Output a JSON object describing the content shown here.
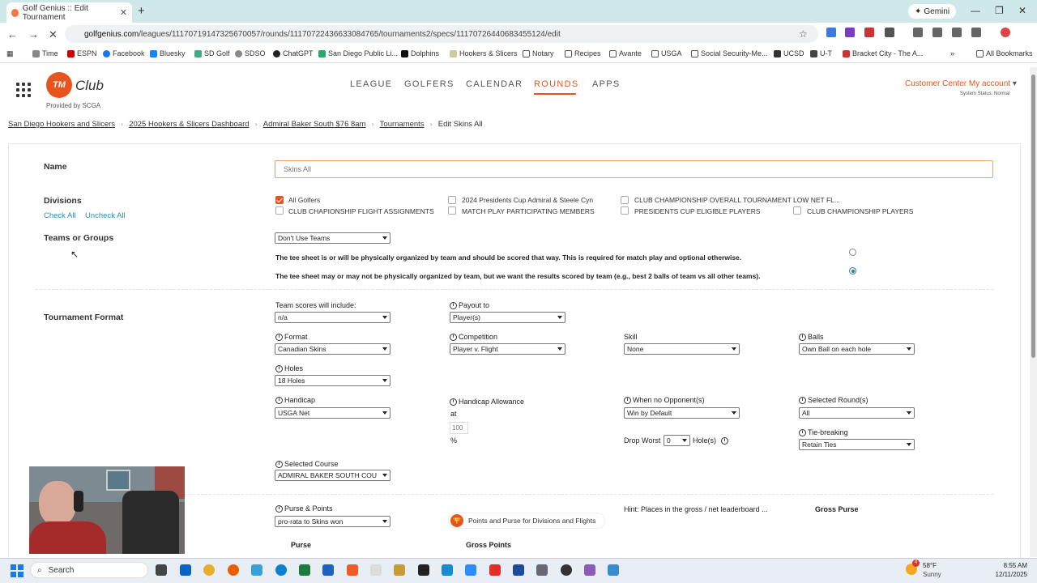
{
  "browser": {
    "tab_title": "Golf Genius :: Edit Tournament",
    "url_host": "golfgenius.com",
    "url_path": "/leagues/11170719147325670057/rounds/11170722436633084765/tournaments2/specs/11170726440683455124/edit",
    "gemini_label": "Gemini",
    "bookmarks": [
      "Time",
      "ESPN",
      "Facebook",
      "Bluesky",
      "SD Golf",
      "SDSO",
      "ChatGPT",
      "San Diego Public Li...",
      "Dolphins",
      "Hookers & Slicers",
      "Notary",
      "Recipes",
      "Avante",
      "USGA",
      "Social Security-Me...",
      "UCSD",
      "U-T",
      "Bracket City - The A..."
    ],
    "all_bookmarks": "All Bookmarks"
  },
  "header": {
    "logo_text": "TM",
    "brand": "Club",
    "provided_by": "Provided by SCGA",
    "nav": [
      "LEAGUE",
      "GOLFERS",
      "CALENDAR",
      "ROUNDS",
      "APPS"
    ],
    "active_nav": "ROUNDS",
    "customer_center": "Customer Center",
    "my_account": "My account",
    "system_status": "System Status: Normal",
    "accent": "#e8541e"
  },
  "breadcrumb": [
    "San Diego Hookers and Slicers",
    "2025 Hookers & Slicers Dashboard",
    "Admiral Baker South $76 8am",
    "Tournaments",
    "Edit Skins All"
  ],
  "form": {
    "name_label": "Name",
    "name_value": "Skins All",
    "divisions_label": "Divisions",
    "check_all": "Check All",
    "uncheck_all": "Uncheck All",
    "divisions": [
      {
        "label": "All Golfers",
        "checked": true
      },
      {
        "label": "2024 Presidents Cup Admiral & Steele Cyn",
        "checked": false
      },
      {
        "label": "CLUB CHAMPIONSHIP OVERALL TOURNAMENT LOW NET FL...",
        "checked": false
      },
      {
        "label": "CLUB CHAPIONSHIP FLIGHT ASSIGNMENTS",
        "checked": false
      },
      {
        "label": "MATCH PLAY PARTICIPATING MEMBERS",
        "checked": false
      },
      {
        "label": "PRESIDENTS CUP ELIGIBLE PLAYERS",
        "checked": false
      },
      {
        "label": "CLUB CHAMPIONSHIP PLAYERS",
        "checked": false
      }
    ],
    "teams_label": "Teams or Groups",
    "teams_value": "Don't Use Teams",
    "teams_opt1": "The tee sheet is or will be physically organized by team and should be scored that way. This is required for match play and optional otherwise.",
    "teams_opt2": "The tee sheet may or may not be physically organized by team, but we want the results scored by team (e.g., best 2 balls of team vs all other teams).",
    "format_section": "Tournament Format",
    "team_scores_label": "Team scores will include:",
    "team_scores_value": "n/a",
    "payout_label": "Payout to",
    "payout_value": "Player(s)",
    "format_label": "Format",
    "format_value": "Canadian Skins",
    "competition_label": "Competition",
    "competition_value": "Player v. Flight",
    "skill_label": "Skill",
    "skill_value": "None",
    "balls_label": "Balls",
    "balls_value": "Own Ball on each hole",
    "holes_label": "Holes",
    "holes_value": "18 Holes",
    "handicap_label": "Handicap",
    "handicap_value": "USGA Net",
    "allowance_label": "Handicap Allowance",
    "allowance_at": "at",
    "allowance_value": "100",
    "allowance_pct": "%",
    "no_opp_label": "When no Opponent(s)",
    "no_opp_value": "Win by Default",
    "rounds_label": "Selected Round(s)",
    "rounds_value": "All",
    "drop_worst_label": "Drop Worst",
    "drop_worst_value": "0",
    "holes_suffix": "Hole(s)",
    "tiebreak_label": "Tie-breaking",
    "tiebreak_value": "Retain Ties",
    "course_label": "Selected Course",
    "course_value": "ADMIRAL BAKER SOUTH COU",
    "purse_points_label": "Purse & Points",
    "purse_points_value": "pro-rata to Skins won",
    "points_purse_button": "Points and Purse for Divisions and Flights",
    "hint": "Hint: Places in the gross / net leaderboard ...",
    "gross_purse": "Gross Purse",
    "purse": "Purse",
    "gross_points": "Gross Points"
  },
  "taskbar": {
    "search": "Search",
    "weather_temp": "58°F",
    "weather_desc": "Sunny",
    "time": "8:55 AM",
    "date": "12/11/2025",
    "badge": "4"
  }
}
